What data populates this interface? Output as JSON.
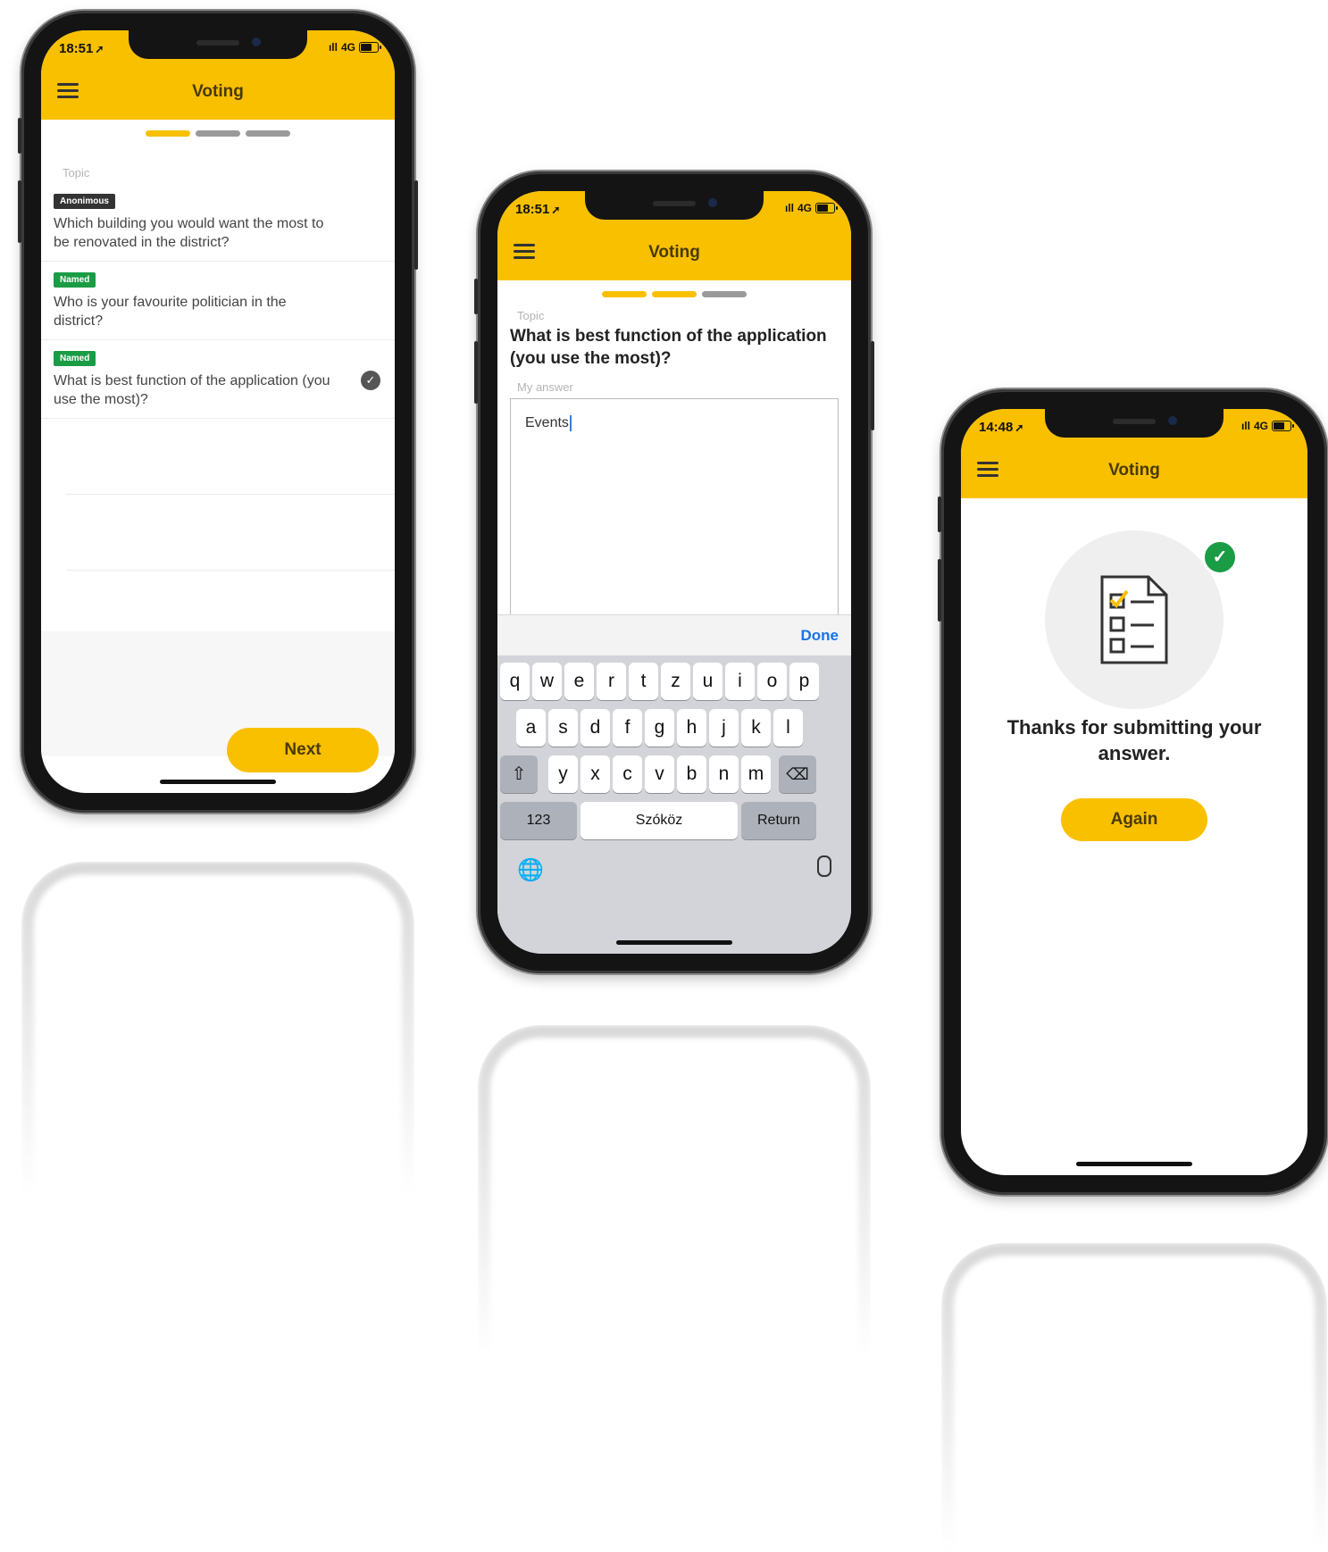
{
  "phone1": {
    "status_time": "18:51",
    "status_network": "4G",
    "header_title": "Voting",
    "topic_label": "Topic",
    "questions": [
      {
        "badge": "Anonimous",
        "text": "Which building you would want the most to be renovated in the district?",
        "selected": false
      },
      {
        "badge": "Named",
        "text": "Who is your favourite politician in the district?",
        "selected": false
      },
      {
        "badge": "Named",
        "text": "What is best function of the application (you use the most)?",
        "selected": true
      }
    ],
    "next_button": "Next"
  },
  "phone2": {
    "status_time": "18:51",
    "status_network": "4G",
    "header_title": "Voting",
    "topic_label": "Topic",
    "question": "What is best function of the application (you use the most)?",
    "answer_label": "My answer",
    "answer_value": "Events",
    "done_label": "Done",
    "keyboard": {
      "row1": [
        "q",
        "w",
        "e",
        "r",
        "t",
        "z",
        "u",
        "i",
        "o",
        "p"
      ],
      "row2": [
        "a",
        "s",
        "d",
        "f",
        "g",
        "h",
        "j",
        "k",
        "l"
      ],
      "row3": [
        "y",
        "x",
        "c",
        "v",
        "b",
        "n",
        "m"
      ],
      "numbers_key": "123",
      "space_key": "Szóköz",
      "return_key": "Return"
    }
  },
  "phone3": {
    "status_time": "14:48",
    "status_network": "4G",
    "header_title": "Voting",
    "thanks_text": "Thanks for submitting your answer.",
    "again_button": "Again"
  },
  "colors": {
    "accent": "#f9c000",
    "named_badge": "#1a9c45",
    "anonymous_badge": "#333333",
    "done_link": "#1a73e8"
  },
  "icons": {
    "menu": "hamburger-icon",
    "selected": "check-icon",
    "success": "check-circle-icon",
    "survey": "checklist-document-icon",
    "keyboard_globe": "globe-icon",
    "keyboard_mic": "microphone-icon",
    "keyboard_shift": "shift-icon",
    "keyboard_delete": "backspace-icon"
  }
}
